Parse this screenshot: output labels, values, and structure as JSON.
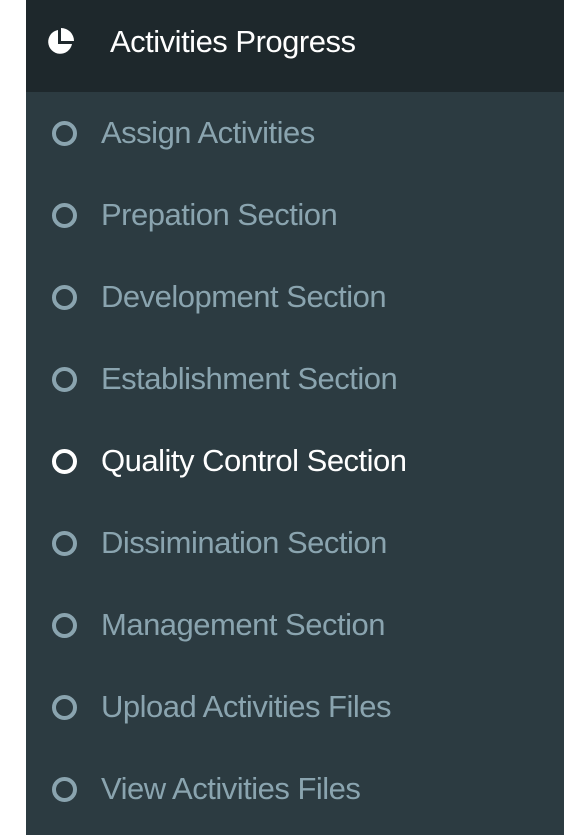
{
  "menu": {
    "header": {
      "icon": "pie-chart-icon",
      "label": "Activities Progress"
    },
    "items": [
      {
        "label": "Assign Activities",
        "icon": "circle-outline-icon",
        "active": false
      },
      {
        "label": "Prepation Section",
        "icon": "circle-outline-icon",
        "active": false
      },
      {
        "label": "Development Section",
        "icon": "circle-outline-icon",
        "active": false
      },
      {
        "label": "Establishment Section",
        "icon": "circle-outline-icon",
        "active": false
      },
      {
        "label": "Quality Control Section",
        "icon": "circle-outline-icon",
        "active": true
      },
      {
        "label": "Dissimination Section",
        "icon": "circle-outline-icon",
        "active": false
      },
      {
        "label": "Management Section",
        "icon": "circle-outline-icon",
        "active": false
      },
      {
        "label": "Upload Activities Files",
        "icon": "circle-outline-icon",
        "active": false
      },
      {
        "label": "View Activities Files",
        "icon": "circle-outline-icon",
        "active": false
      }
    ]
  },
  "colors": {
    "sidebar_bg": "#2c3b41",
    "header_bg": "#1e282c",
    "item_text": "#8aa4af",
    "active_text": "#ffffff"
  }
}
